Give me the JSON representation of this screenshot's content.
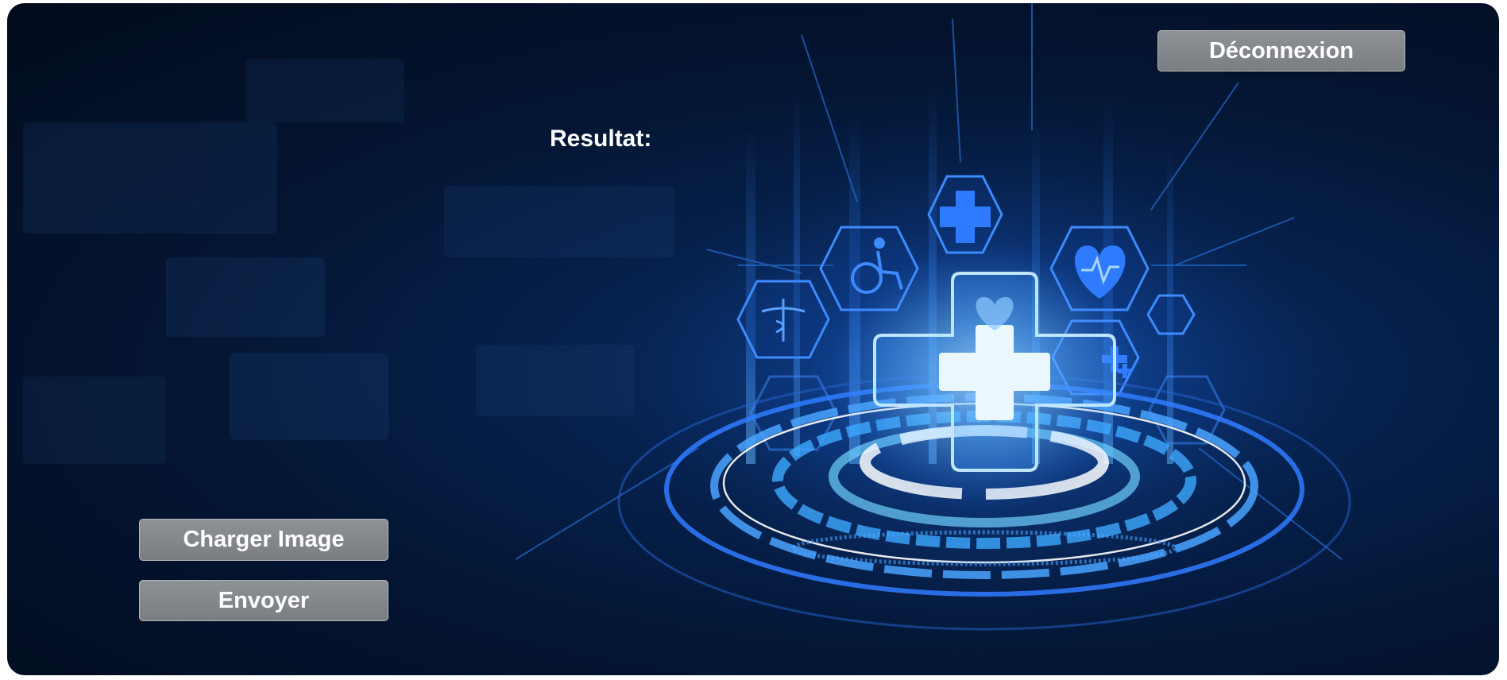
{
  "header": {
    "logout_label": "Déconnexion"
  },
  "result": {
    "label": "Resultat:",
    "value": ""
  },
  "actions": {
    "load_image_label": "Charger Image",
    "send_label": "Envoyer"
  },
  "background": {
    "description_icons": [
      "medical-cross-icon",
      "wheelchair-icon",
      "heart-rate-icon",
      "caduceus-icon",
      "plus-icon"
    ],
    "accent_color": "#1e7bff",
    "base_color": "#03102a"
  }
}
